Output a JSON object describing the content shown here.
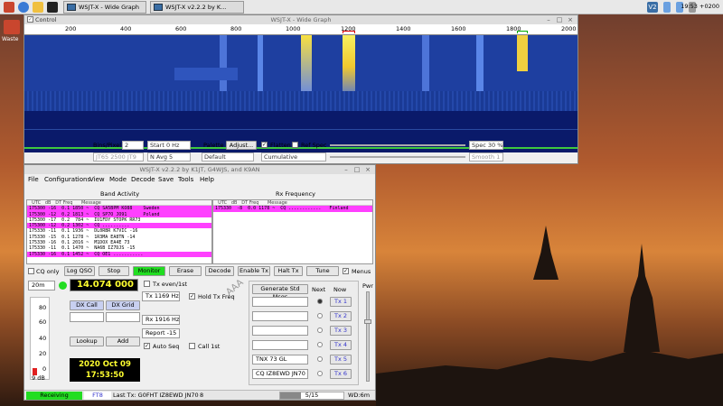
{
  "taskbar": {
    "tasks": [
      {
        "label": "WSJT-X - Wide Graph"
      },
      {
        "label": "WSJT-X   v2.2.2   by K..."
      }
    ],
    "clock": "19:53 +0200"
  },
  "desktop": {
    "icon_label": "Waste"
  },
  "wide_graph": {
    "title": "WSJT-X - Wide Graph",
    "control_label": "Control",
    "ruler": [
      "200",
      "400",
      "600",
      "800",
      "1000",
      "1200",
      "1400",
      "1600",
      "1800",
      "2000"
    ],
    "bins_label": "Bins/Pixel",
    "bins_value": "2",
    "start_value": "Start 0 Hz",
    "palette_label": "Palette",
    "adjust_label": "Adjust...",
    "flatten_label": "Flatten",
    "refspec_label": "Ref Spec",
    "spec_value": "Spec 30 %",
    "mode_value": "JT65  2500  JT9",
    "navg_value": "N Avg 5",
    "palette_value": "Default",
    "cumulative_value": "Cumulative",
    "smooth_value": "Smooth  1"
  },
  "main": {
    "title": "WSJT-X   v2.2.2   by K1JT, G4WJS, and K9AN",
    "menus": [
      "File",
      "Configurations",
      "View",
      "Mode",
      "Decode",
      "Save",
      "Tools",
      "Help"
    ],
    "band_activity_title": "Band Activity",
    "rx_frequency_title": "Rx Frequency",
    "band_header": "  UTC   dB   DT Freq      Message",
    "rx_header": "  UTC   dB   DT Freq      Message",
    "band_rows": [
      {
        "text": "175300 -16  0.1 1850 ~  CQ SA5BPM KO88    Sweden",
        "bg": "#ff40ff"
      },
      {
        "text": "175300 -12  0.2 1813 ~  CQ SP7O JO91      Poland",
        "bg": "#ff40ff"
      },
      {
        "text": "175300 -17  0.2  784 ~  IU1FDY STOPK RR73",
        "bg": "#ffffff"
      },
      {
        "text": "175300 -12  0.2 1302 ~  CQ ..........",
        "bg": "#ff40ff"
      },
      {
        "text": "175330 -11  0.1 1936 ~  DL0RBR K7VIC -16",
        "bg": "#ffffff"
      },
      {
        "text": "175330 -15  0.1 1278 ~  1R3MA EA8TN -14",
        "bg": "#ffffff"
      },
      {
        "text": "175330 -16  0.1 2016 ~  M1DOX EA4E 73",
        "bg": "#ffffff"
      },
      {
        "text": "175330 -11  0.1 1470 ~  NA6B IZ7DJS -15",
        "bg": "#ffffff"
      },
      {
        "text": "175330 -16  0.1 1452 ~  CQ OE1 ...........",
        "bg": "#ff40ff"
      }
    ],
    "rx_rows": [
      {
        "text": "175330  -8  0.0 1178 ~  CQ ............   Finland",
        "bg": "#ff40ff"
      }
    ],
    "buttons": {
      "cq_only": "CQ only",
      "log_qso": "Log QSO",
      "stop": "Stop",
      "monitor": "Monitor",
      "erase": "Erase",
      "decode": "Decode",
      "enable_tx": "Enable Tx",
      "halt_tx": "Halt Tx",
      "tune": "Tune",
      "menus": "Menus"
    },
    "band": "20m",
    "frequency": "14.074 000",
    "tx_even": "Tx even/1st",
    "tx_freq": "Tx  1169  Hz",
    "hold_tx": "Hold Tx Freq",
    "rx_freq": "Rx  1916  Hz",
    "report": "Report  -15",
    "auto_seq": "Auto Seq",
    "call_1st": "Call 1st",
    "dx_call_label": "DX Call",
    "dx_grid_label": "DX Grid",
    "lookup": "Lookup",
    "add": "Add",
    "date": "2020 Oct 09",
    "time": "17:53:50",
    "meter_ticks": [
      "80",
      "60",
      "40",
      "20",
      "0"
    ],
    "meter_db": "9 dB",
    "meter_level": 0.1,
    "gen_std": "Generate Std Msgs",
    "next_label": "Next",
    "now_label": "Now",
    "tx_msgs": [
      "",
      "",
      "",
      "",
      "TNX 73 GL",
      "CQ IZ8EWD JN70"
    ],
    "tx_buttons": [
      "Tx 1",
      "Tx 2",
      "Tx 3",
      "Tx 4",
      "Tx 5",
      "Tx 6"
    ],
    "pwr": "Pwr",
    "aaa": "AAA",
    "status": {
      "receiving": "Receiving",
      "ft8": "FT8",
      "last_tx": "Last Tx: G0FHT IZ8EWD JN70",
      "num": "8",
      "progress": "5/15",
      "wd": "WD:6m"
    }
  },
  "colors": {
    "accent_green": "#22dd22",
    "magenta": "#ff40ff",
    "waterfall_blue": "#1e3fa0"
  }
}
